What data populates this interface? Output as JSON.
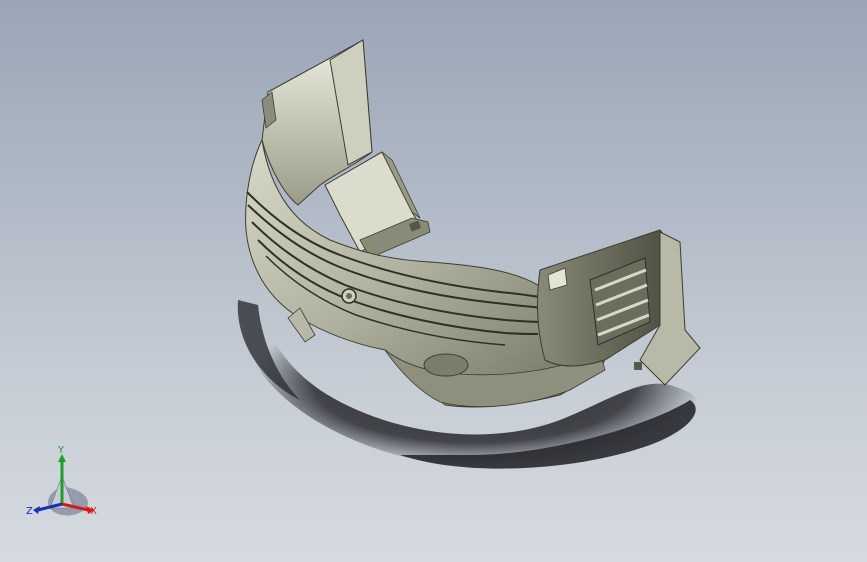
{
  "viewport": {
    "background_top": "#9aa5b6",
    "background_bottom": "#d6dae0",
    "model": {
      "kind": "3d-part-render",
      "body_color": "#a7a796",
      "shadow_color": "#2d2f33",
      "edge_color": "#3d3d33"
    }
  },
  "triad": {
    "x_label": "X",
    "y_label": "Y",
    "z_label": "Z",
    "x_color": "#d21a1a",
    "y_color": "#1f9e2a",
    "z_color": "#1b2fb5"
  }
}
